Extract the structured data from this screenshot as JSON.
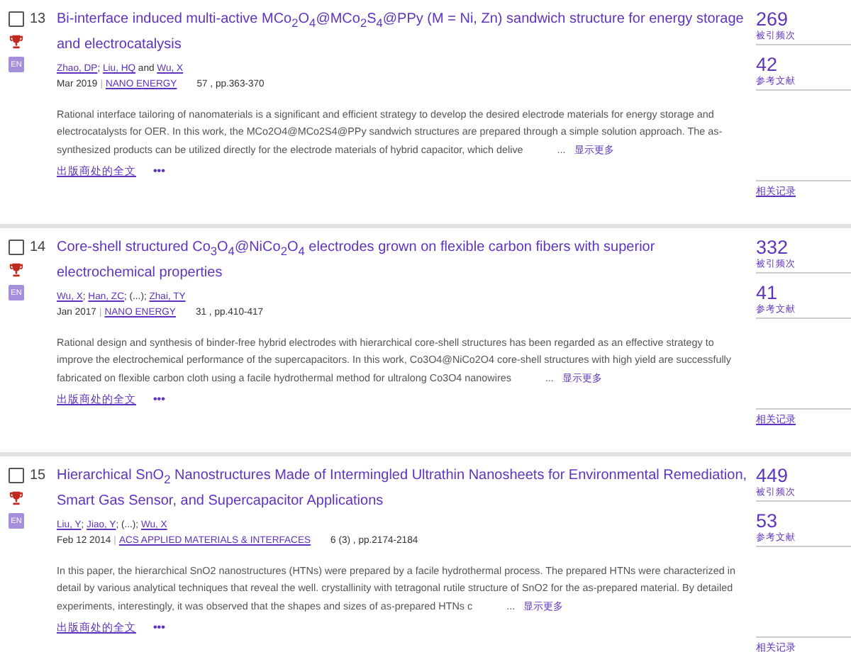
{
  "records": [
    {
      "number": "13",
      "checked": false,
      "award": true,
      "language": "EN",
      "title": "Bi-interface induced multi-active MCo$_{2}$O$_{4}$@MCo$_{2}$S$_{4}$@PPy (M = Ni, Zn) sandwich structure for energy storage and electrocatalysis",
      "authors": [
        {
          "text": "Zhao, DP",
          "kind": "link"
        },
        {
          "text": "; ",
          "kind": "text"
        },
        {
          "text": "Liu, HQ",
          "kind": "link"
        },
        {
          "text": " and ",
          "kind": "text"
        },
        {
          "text": "Wu, X",
          "kind": "link"
        }
      ],
      "date": "Mar 2019",
      "separator": "|",
      "journal": "NANO ENERGY",
      "pages": "57 , pp.363-370",
      "abstract": "Rational interface tailoring of nanomaterials is a significant and efficient strategy to develop the desired electrode materials for energy storage and electrocatalysts for OER. In this work, the MCo2O4@MCo2S4@PPy sandwich structures are prepared through a simple solution approach. The as-synthesized products can be utilized directly for the electrode materials of hybrid capacitor, which delive",
      "ellipsis": "...",
      "show_more": "显示更多",
      "full_text": "出版商处的全文",
      "more": "•••",
      "citations": "269",
      "citations_label": "被引频次",
      "references": "42",
      "references_label": "参考文献",
      "related": "相关记录"
    },
    {
      "number": "14",
      "checked": false,
      "award": true,
      "language": "EN",
      "title": "Core-shell structured Co$_{3}$O$_{4}$@NiCo$_{2}$O$_{4}$ electrodes grown on flexible carbon fibers with superior electrochemical properties",
      "authors": [
        {
          "text": "Wu, X",
          "kind": "link"
        },
        {
          "text": "; ",
          "kind": "text"
        },
        {
          "text": "Han, ZC",
          "kind": "link"
        },
        {
          "text": "; (...); ",
          "kind": "text"
        },
        {
          "text": "Zhai, TY",
          "kind": "link"
        }
      ],
      "date": "Jan 2017",
      "separator": "|",
      "journal": "NANO ENERGY",
      "pages": "31 , pp.410-417",
      "abstract": "Rational design and synthesis of binder-free hybrid electrodes with hierarchical core-shell structures has been regarded as an effective strategy to improve the electrochemical performance of the supercapacitors. In this work, Co3O4@NiCo2O4 core-shell structures with high yield are successfully fabricated on flexible carbon cloth using a facile hydrothermal method for ultralong Co3O4 nanowires",
      "ellipsis": "...",
      "show_more": "显示更多",
      "full_text": "出版商处的全文",
      "more": "•••",
      "citations": "332",
      "citations_label": "被引频次",
      "references": "41",
      "references_label": "参考文献",
      "related": "相关记录"
    },
    {
      "number": "15",
      "checked": false,
      "award": true,
      "language": "EN",
      "title": "Hierarchical SnO$_{2}$ Nanostructures Made of Intermingled Ultrathin Nanosheets for Environmental Remediation, Smart Gas Sensor, and Supercapacitor Applications",
      "authors": [
        {
          "text": "Liu, Y",
          "kind": "link"
        },
        {
          "text": "; ",
          "kind": "text"
        },
        {
          "text": "Jiao, Y",
          "kind": "link"
        },
        {
          "text": "; (...); ",
          "kind": "text"
        },
        {
          "text": "Wu, X",
          "kind": "link"
        }
      ],
      "date": "Feb 12 2014",
      "separator": "|",
      "journal": "ACS APPLIED MATERIALS & INTERFACES",
      "pages": "6 (3) , pp.2174-2184",
      "abstract": "In this paper, the hierarchical SnO2 nanostructures (HTNs) were prepared by a facile hydrothermal process. The prepared HTNs were characterized in detail by various analytical techniques that reveal the well. crystallinity with tetragonal rutile structure of SnO2 for the as-prepared material. By detailed experiments, interestingly, it was observed that the shapes and sizes of as-prepared HTNs c",
      "ellipsis": "...",
      "show_more": "显示更多",
      "full_text": "出版商处的全文",
      "more": "•••",
      "citations": "449",
      "citations_label": "被引频次",
      "references": "53",
      "references_label": "参考文献",
      "related": "相关记录"
    }
  ]
}
